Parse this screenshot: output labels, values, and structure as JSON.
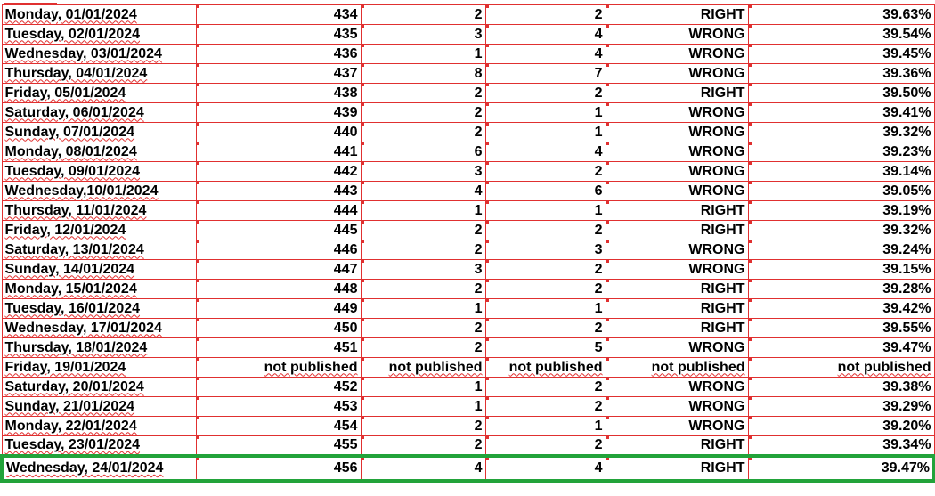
{
  "rows": [
    {
      "date": "Monday, 01/01/2024",
      "num": "434",
      "a": "2",
      "b": "2",
      "result": "RIGHT",
      "pct": "39.63%"
    },
    {
      "date": "Tuesday, 02/01/2024",
      "num": "435",
      "a": "3",
      "b": "4",
      "result": "WRONG",
      "pct": "39.54%"
    },
    {
      "date": "Wednesday, 03/01/2024",
      "num": "436",
      "a": "1",
      "b": "4",
      "result": "WRONG",
      "pct": "39.45%"
    },
    {
      "date": "Thursday, 04/01/2024",
      "num": "437",
      "a": "8",
      "b": "7",
      "result": "WRONG",
      "pct": "39.36%"
    },
    {
      "date": "Friday, 05/01/2024",
      "num": "438",
      "a": "2",
      "b": "2",
      "result": "RIGHT",
      "pct": "39.50%"
    },
    {
      "date": "Saturday, 06/01/2024",
      "num": "439",
      "a": "2",
      "b": "1",
      "result": "WRONG",
      "pct": "39.41%"
    },
    {
      "date": "Sunday, 07/01/2024",
      "num": "440",
      "a": "2",
      "b": "1",
      "result": "WRONG",
      "pct": "39.32%"
    },
    {
      "date": "Monday, 08/01/2024",
      "num": "441",
      "a": "6",
      "b": "4",
      "result": "WRONG",
      "pct": "39.23%"
    },
    {
      "date": "Tuesday, 09/01/2024",
      "num": "442",
      "a": "3",
      "b": "2",
      "result": "WRONG",
      "pct": "39.14%"
    },
    {
      "date": "Wednesday,10/01/2024",
      "num": "443",
      "a": "4",
      "b": "6",
      "result": "WRONG",
      "pct": "39.05%"
    },
    {
      "date": "Thursday, 11/01/2024",
      "num": "444",
      "a": "1",
      "b": "1",
      "result": "RIGHT",
      "pct": "39.19%"
    },
    {
      "date": "Friday, 12/01/2024",
      "num": "445",
      "a": "2",
      "b": "2",
      "result": "RIGHT",
      "pct": "39.32%"
    },
    {
      "date": "Saturday, 13/01/2024",
      "num": "446",
      "a": "2",
      "b": "3",
      "result": "WRONG",
      "pct": "39.24%"
    },
    {
      "date": "Sunday, 14/01/2024",
      "num": "447",
      "a": "3",
      "b": "2",
      "result": "WRONG",
      "pct": "39.15%"
    },
    {
      "date": "Monday, 15/01/2024",
      "num": "448",
      "a": "2",
      "b": "2",
      "result": "RIGHT",
      "pct": "39.28%"
    },
    {
      "date": "Tuesday, 16/01/2024",
      "num": "449",
      "a": "1",
      "b": "1",
      "result": "RIGHT",
      "pct": "39.42%"
    },
    {
      "date": "Wednesday, 17/01/2024",
      "num": "450",
      "a": "2",
      "b": "2",
      "result": "RIGHT",
      "pct": "39.55%"
    },
    {
      "date": "Thursday, 18/01/2024",
      "num": "451",
      "a": "2",
      "b": "5",
      "result": "WRONG",
      "pct": "39.47%"
    },
    {
      "date": "Friday, 19/01/2024",
      "num": "not published",
      "a": "not published",
      "b": "not published",
      "result": "not published",
      "pct": "not published"
    },
    {
      "date": "Saturday, 20/01/2024",
      "num": "452",
      "a": "1",
      "b": "2",
      "result": "WRONG",
      "pct": "39.38%"
    },
    {
      "date": "Sunday, 21/01/2024",
      "num": "453",
      "a": "1",
      "b": "2",
      "result": "WRONG",
      "pct": "39.29%"
    },
    {
      "date": "Monday, 22/01/2024",
      "num": "454",
      "a": "2",
      "b": "1",
      "result": "WRONG",
      "pct": "39.20%"
    },
    {
      "date": "Tuesday, 23/01/2024",
      "num": "455",
      "a": "2",
      "b": "2",
      "result": "RIGHT",
      "pct": "39.34%"
    },
    {
      "date": "Wednesday, 24/01/2024",
      "num": "456",
      "a": "4",
      "b": "4",
      "result": "RIGHT",
      "pct": "39.47%"
    }
  ],
  "highlight_row_index": 23,
  "colors": {
    "cell_border": "#e03030",
    "highlight_border": "#22a33a",
    "text": "#000000"
  }
}
